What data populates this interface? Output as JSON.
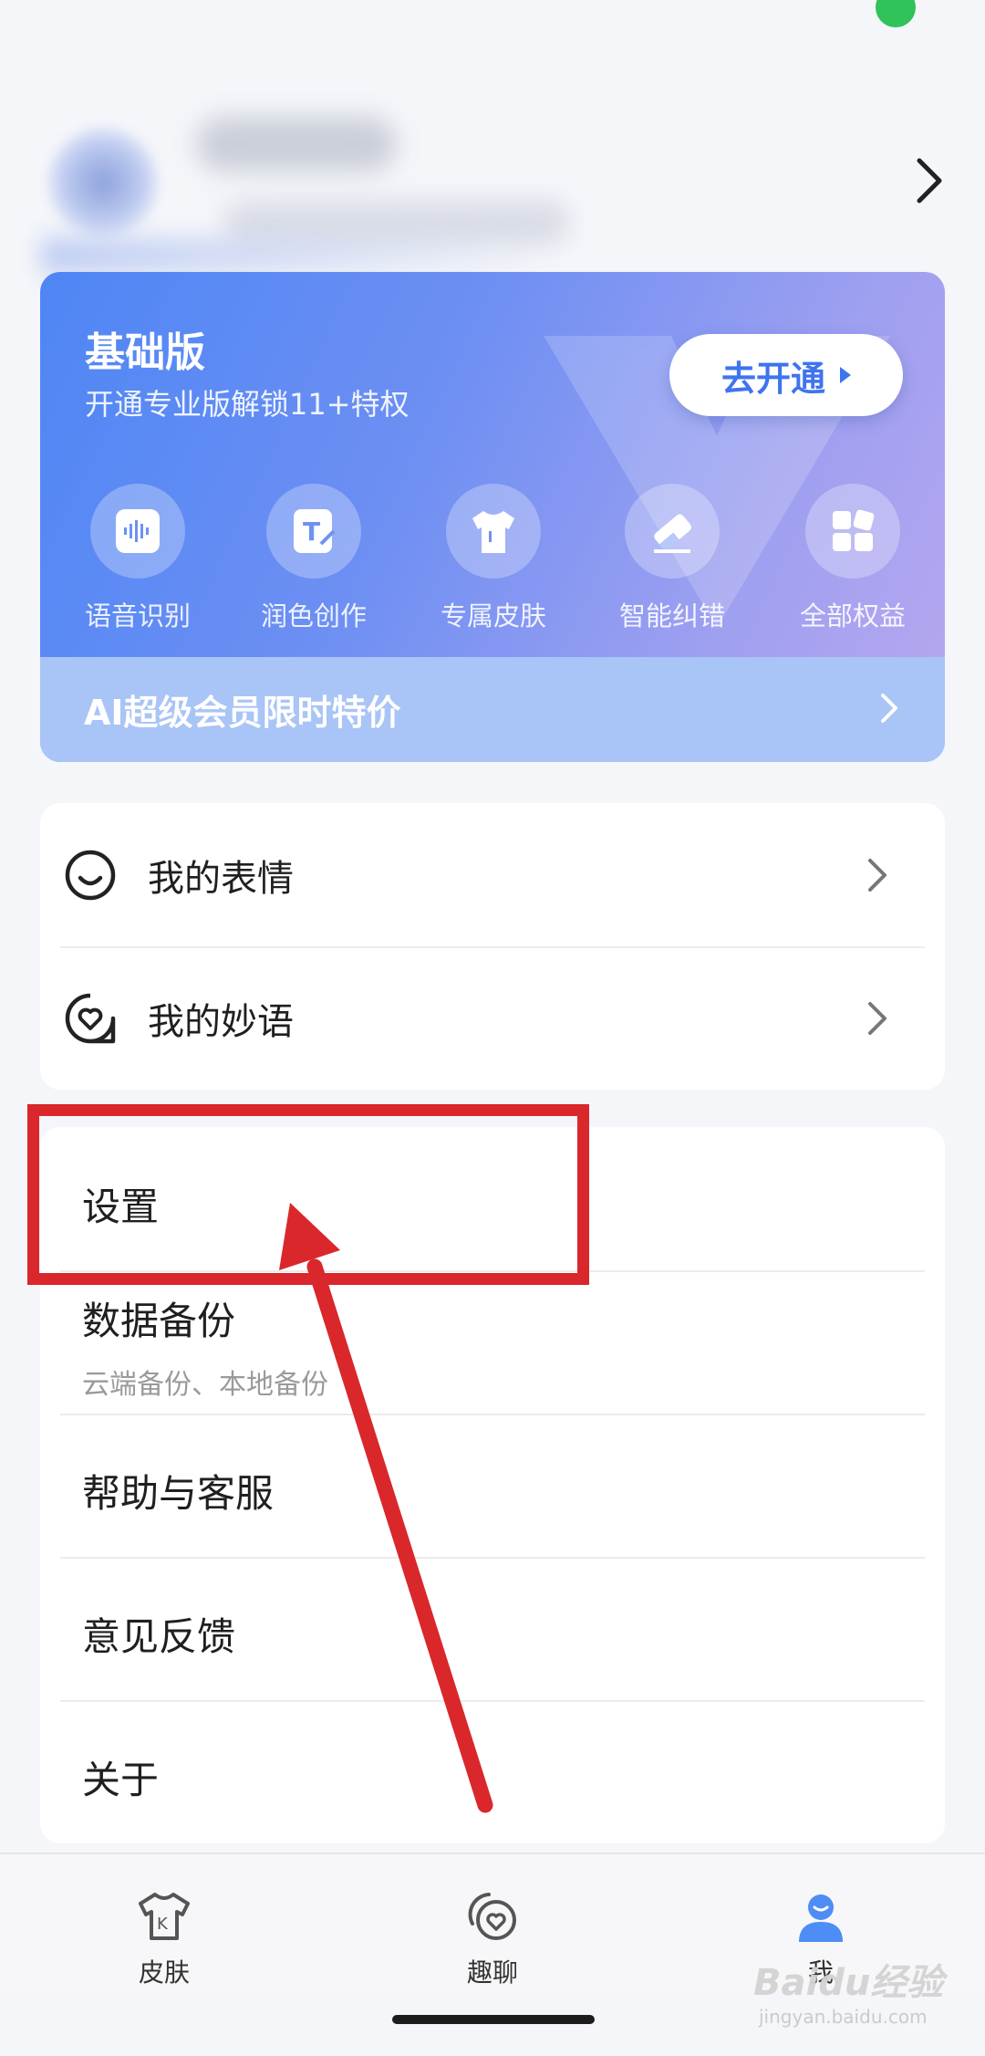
{
  "profile": {
    "name_hidden": true
  },
  "vip": {
    "title": "基础版",
    "subtitle": "开通专业版解锁11+特权",
    "open_button": "去开通",
    "perks": [
      {
        "label": "语音识别",
        "icon": "voice-wave-icon"
      },
      {
        "label": "润色创作",
        "icon": "text-edit-icon"
      },
      {
        "label": "专属皮肤",
        "icon": "tshirt-icon"
      },
      {
        "label": "智能纠错",
        "icon": "eraser-icon"
      },
      {
        "label": "全部权益",
        "icon": "grid-icon"
      }
    ],
    "banner": "AI超级会员限时特价"
  },
  "list1": [
    {
      "label": "我的表情",
      "icon": "smile-icon"
    },
    {
      "label": "我的妙语",
      "icon": "heart-bubble-icon"
    }
  ],
  "list2": [
    {
      "label": "设置"
    },
    {
      "label": "数据备份",
      "sub": "云端备份、本地备份"
    },
    {
      "label": "帮助与客服"
    },
    {
      "label": "意见反馈"
    },
    {
      "label": "关于"
    }
  ],
  "tabs": [
    {
      "label": "皮肤",
      "icon": "skin-tshirt-icon"
    },
    {
      "label": "趣聊",
      "icon": "chat-heart-icon"
    },
    {
      "label": "我",
      "icon": "person-icon",
      "active": true
    }
  ],
  "watermark": {
    "text": "Baidu经验",
    "url": "jingyan.baidu.com"
  },
  "colors": {
    "accent": "#3f74ef",
    "annotation": "#d9272c",
    "tab_active": "#4d8df5"
  }
}
